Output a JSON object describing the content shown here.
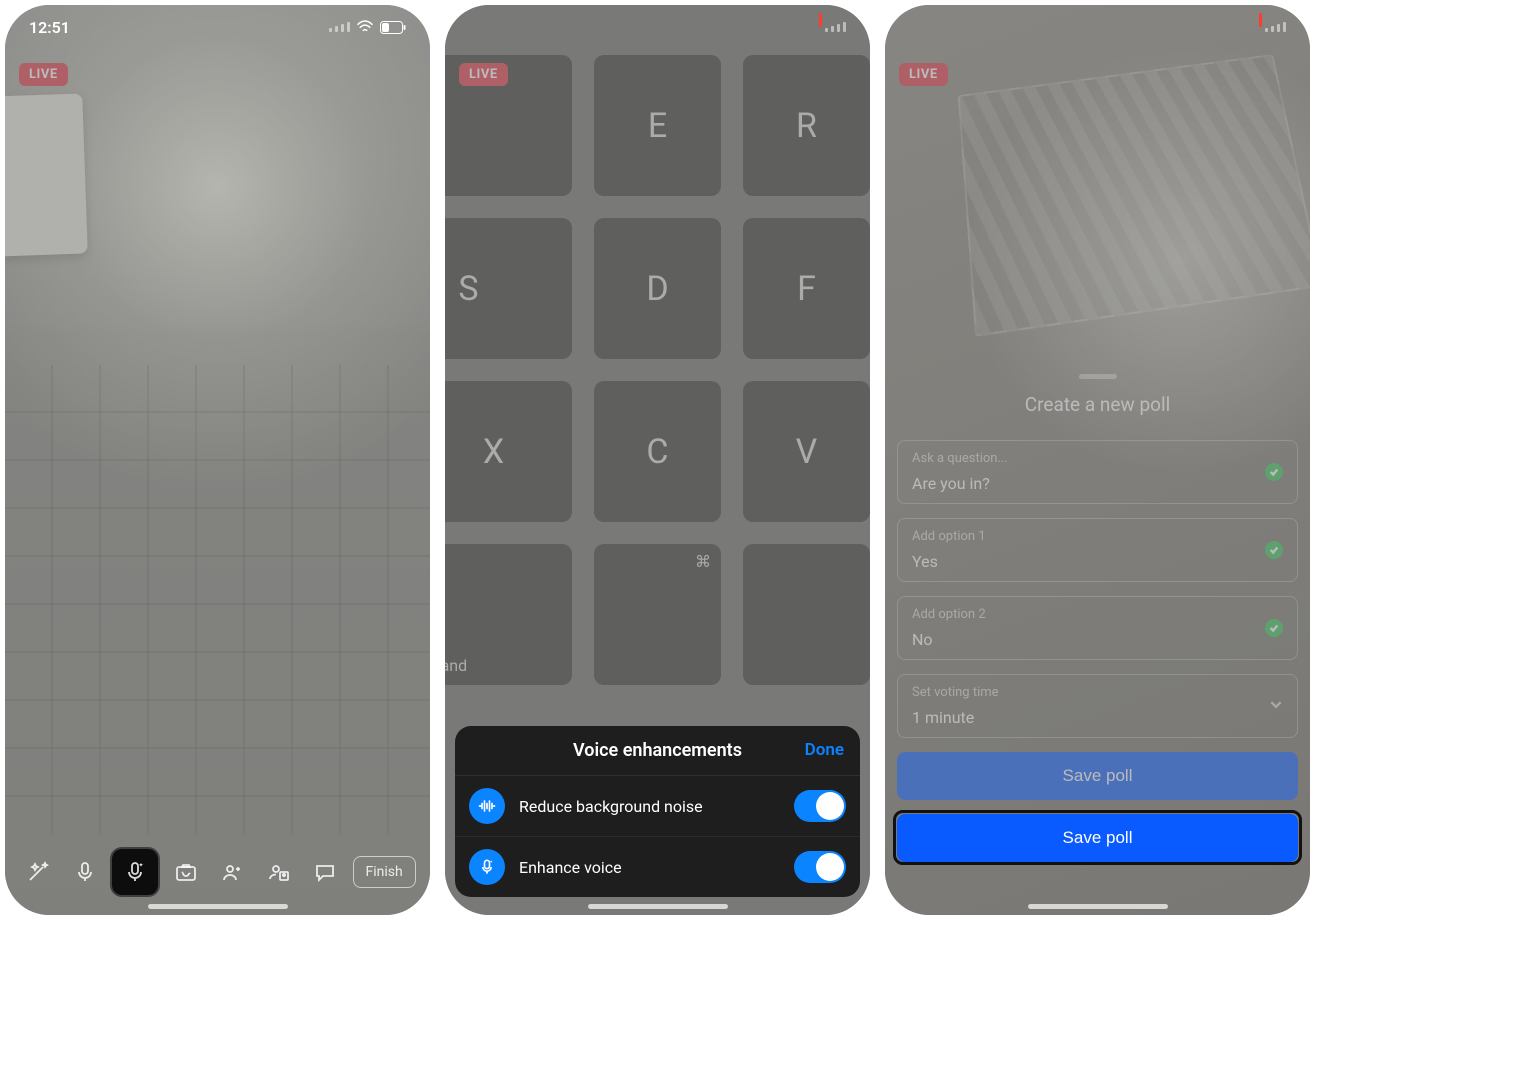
{
  "statusbar": {
    "time": "12:51"
  },
  "live_badge": "LIVE",
  "screen1": {
    "finish_label": "Finish"
  },
  "screen2": {
    "keys": {
      "e": "E",
      "r": "R",
      "s": "S",
      "d": "D",
      "f": "F",
      "x": "X",
      "c": "C",
      "v": "V",
      "command": "command",
      "cmd_symbol": "⌘"
    },
    "sheet": {
      "title": "Voice enhancements",
      "done": "Done",
      "row1_label": "Reduce background noise",
      "row2_label": "Enhance voice"
    }
  },
  "screen3": {
    "poll": {
      "title": "Create a new poll",
      "question_label": "Ask a question...",
      "question_value": "Are you in?",
      "option1_label": "Add option 1",
      "option1_value": "Yes",
      "option2_label": "Add option 2",
      "option2_value": "No",
      "time_label": "Set voting time",
      "time_value": "1 minute",
      "save_label": "Save poll"
    }
  }
}
